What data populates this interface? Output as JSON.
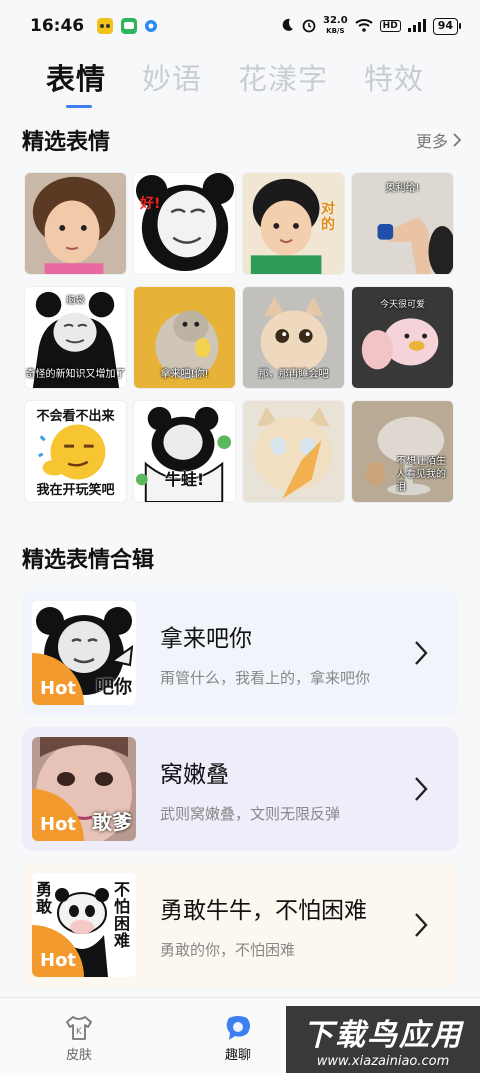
{
  "status_bar": {
    "time": "16:46",
    "net_speed_value": "32.0",
    "net_speed_unit": "KB/S",
    "hd_label": "HD",
    "battery": "94"
  },
  "tabs": [
    {
      "label": "表情",
      "active": true
    },
    {
      "label": "妙语",
      "active": false
    },
    {
      "label": "花漾字",
      "active": false
    },
    {
      "label": "特效",
      "active": false
    }
  ],
  "featured": {
    "title": "精选表情",
    "more_label": "更多",
    "captions": {
      "t1": "",
      "t2": "好!",
      "t3": "对的",
      "t4": "奥利给!",
      "t5_top": "脑袋",
      "t5": "奇怪的新知识又增加了",
      "t6": "拿来吧!你!",
      "t7": "那，那再睡会吧",
      "t8": "今天很可爱",
      "t9_top": "不会看不出来",
      "t9": "我在开玩笑吧",
      "t10": "牛蛙!",
      "t11": "",
      "t12": "不想让陌生人看见我的泪"
    }
  },
  "collections": {
    "title": "精选表情合辑",
    "hot_label": "Hot",
    "items": [
      {
        "title": "拿来吧你",
        "subtitle": "甭管什么，我看上的，拿来吧你",
        "thumb_caption": "吧你"
      },
      {
        "title": "窝嫩叠",
        "subtitle": "武则窝嫩叠，文则无限反弹",
        "thumb_caption": "敢爹"
      },
      {
        "title": "勇敢牛牛，不怕困难",
        "subtitle": "勇敢的你，不怕困难",
        "thumb_caption_left": "勇敢",
        "thumb_caption_right": "不怕困难"
      }
    ]
  },
  "bottom_nav": {
    "skin_label": "皮肤",
    "chat_label": "趣聊"
  },
  "watermark": {
    "line1": "下载鸟应用",
    "line2": "www.xiazainiao.com"
  },
  "colors": {
    "accent": "#3d7ef0",
    "hot_badge": "#f39a2e",
    "card1_bg": "#f1f4fb",
    "card2_bg": "#eeeefb",
    "card3_bg": "#fdf8ef"
  }
}
